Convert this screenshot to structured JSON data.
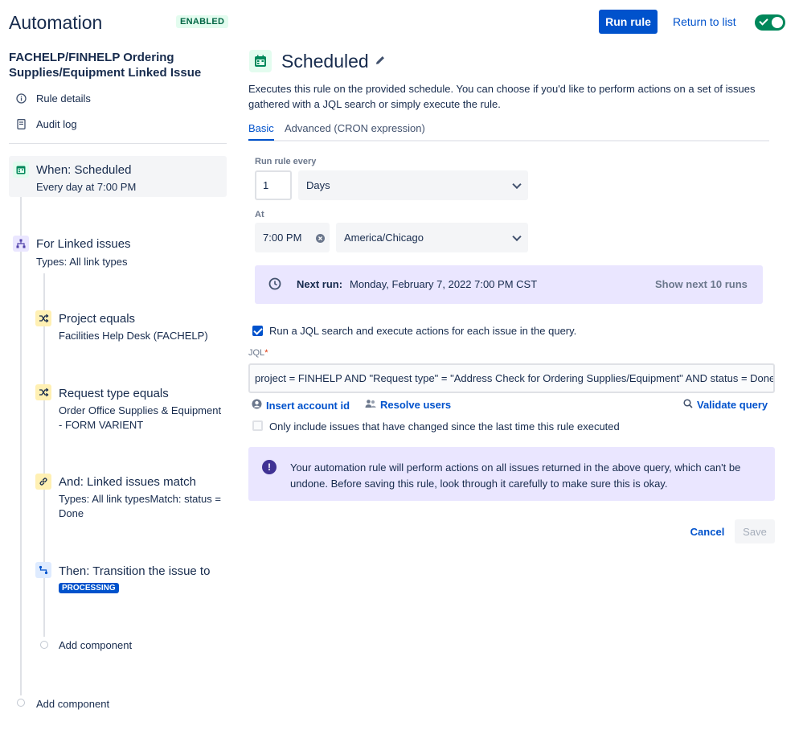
{
  "header": {
    "title": "Automation",
    "status_badge": "ENABLED",
    "run_rule_label": "Run rule",
    "return_label": "Return to list"
  },
  "sidebar": {
    "rule_name": "FACHELP/FINHELP Ordering Supplies/Equipment Linked Issue",
    "links": [
      {
        "label": "Rule details",
        "icon": "info-icon"
      },
      {
        "label": "Audit log",
        "icon": "document-icon"
      }
    ],
    "trigger": {
      "title": "When: Scheduled",
      "subtitle": "Every day at 7:00 PM",
      "icon": "calendar-icon"
    },
    "branch": {
      "title": "For Linked issues",
      "subtitle": "Types: All link types",
      "icon": "hierarchy-icon"
    },
    "components": [
      {
        "title": "Project equals",
        "subtitle": "Facilities Help Desk (FACHELP)",
        "icon": "shuffle-icon"
      },
      {
        "title": "Request type equals",
        "subtitle": "Order Office Supplies & Equipment - FORM VARIENT",
        "icon": "shuffle-icon"
      },
      {
        "title": "And: Linked issues match",
        "subtitle": "Types: All link typesMatch: status = Done",
        "icon": "link-icon"
      },
      {
        "title": "Then: Transition the issue to",
        "lozenge": "PROCESSING",
        "icon": "transition-icon"
      }
    ],
    "add_component_inner": "Add component",
    "add_component_outer": "Add component"
  },
  "panel": {
    "title": "Scheduled",
    "description": "Executes this rule on the provided schedule. You can choose if you'd like to perform actions on a set of issues gathered with a JQL search or simply execute the rule.",
    "tabs": [
      {
        "label": "Basic",
        "active": true
      },
      {
        "label": "Advanced (CRON expression)",
        "active": false
      }
    ],
    "run_every_label": "Run rule every",
    "run_every_value": "1",
    "interval_unit": "Days",
    "at_label": "At",
    "time_value": "7:00 PM",
    "timezone": "America/Chicago",
    "next_run_label": "Next run:",
    "next_run_value": "Monday, February 7, 2022 7:00 PM CST",
    "show_next_label": "Show next 10 runs",
    "jql_checkbox_label": "Run a JQL search and execute actions for each issue in the query.",
    "jql_checkbox_checked": true,
    "jql_label": "JQL",
    "jql_required_mark": "*",
    "jql_value": "project = FINHELP AND \"Request type\" = \"Address Check for Ordering Supplies/Equipment\" AND status = Done",
    "insert_account_label": "Insert account id",
    "resolve_users_label": "Resolve users",
    "validate_query_label": "Validate query",
    "changed_checkbox_label": "Only include issues that have changed since the last time this rule executed",
    "changed_checkbox_checked": false,
    "warning_text": "Your automation rule will perform actions on all issues returned in the above query, which can't be undone. Before saving this rule, look through it carefully to make sure this is okay.",
    "cancel_label": "Cancel",
    "save_label": "Save"
  },
  "colors": {
    "primary": "#0052cc",
    "success": "#00875a",
    "discovery_bg": "#eae6ff",
    "discovery_icon": "#403294"
  }
}
